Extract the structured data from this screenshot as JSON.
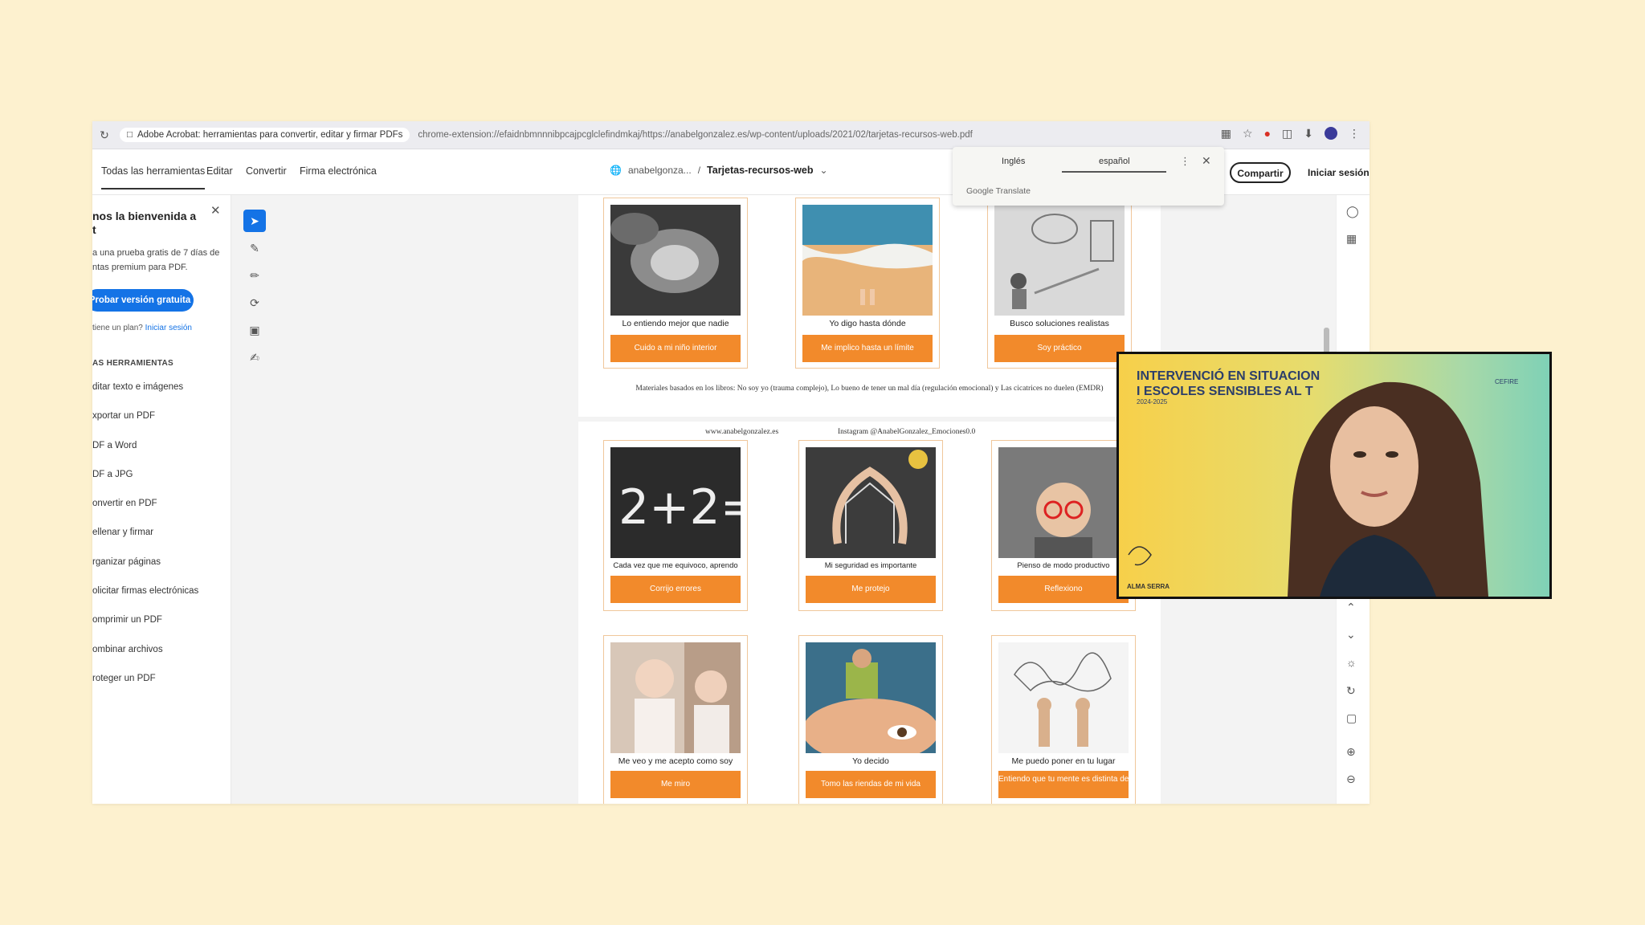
{
  "browser": {
    "tab_label": "Adobe Acrobat: herramientas para convertir, editar y firmar PDFs",
    "url": "chrome-extension://efaidnbmnnnibpcajpcglclefindmkaj/https://anabelgonzalez.es/wp-content/uploads/2021/02/tarjetas-recursos-web.pdf"
  },
  "acrobat": {
    "menu": [
      "Todas las herramientas",
      "Editar",
      "Convertir",
      "Firma electrónica"
    ],
    "doc_path_prefix": "anabelgonza...",
    "doc_separator": "/",
    "doc_name": "Tarjetas-recursos-web",
    "share": "Compartir",
    "login": "Iniciar sesión"
  },
  "translate": {
    "lang_from": "Inglés",
    "lang_to": "español",
    "brand": "Google Translate"
  },
  "left_panel": {
    "title_line1": "nos la bienvenida a",
    "title_line2": "t",
    "desc_line1": "a una prueba gratis de 7 días de",
    "desc_line2": "ntas premium para PDF.",
    "trial_button": "Probar versión gratuita",
    "plan_text": "tiene un plan?",
    "plan_link": "Iniciar sesión",
    "tools_heading": "AS HERRAMIENTAS",
    "tools": [
      "ditar texto e imágenes",
      "xportar un PDF",
      "DF a Word",
      "DF a JPG",
      "onvertir en PDF",
      "ellenar y firmar",
      "rganizar páginas",
      "olicitar firmas electrónicas",
      "omprimir un PDF",
      "ombinar archivos",
      "roteger un PDF"
    ]
  },
  "pdf": {
    "page1_cards": [
      {
        "caption": "Lo entiendo mejor que nadie",
        "button": "Cuido a mi niño interior"
      },
      {
        "caption": "Yo digo hasta dónde",
        "button": "Me implico hasta un límite"
      },
      {
        "caption": "Busco soluciones realistas",
        "button": "Soy práctico"
      }
    ],
    "page1_note": "Materiales basados en los libros: No soy yo (trauma complejo), Lo bueno de tener un mal día (regulación emocional) y Las cicatrices no duelen (EMDR)",
    "page2_website": "www.anabelgonzalez.es",
    "page2_instagram": "Instagram @AnabelGonzalez_Emociones0.0",
    "page2_cards": [
      {
        "caption": "Cada vez que me equivoco, aprendo",
        "button": "Corrijo errores"
      },
      {
        "caption": "Mi seguridad es importante",
        "button": "Me protejo"
      },
      {
        "caption": "Pienso de modo productivo",
        "button": "Reflexiono"
      },
      {
        "caption": "Me veo y me acepto como soy",
        "button": "Me miro"
      },
      {
        "caption": "Yo decido",
        "button": "Tomo las riendas de mi vida"
      },
      {
        "caption": "Me puedo poner en tu lugar",
        "button": "Entiendo que tu mente es distinta de la mía"
      }
    ]
  },
  "webcam": {
    "title_line1": "INTERVENCIÓ EN SITUACION",
    "title_line2": "I ESCOLES SENSIBLES AL T",
    "year": "2024-2025",
    "logo": "CEFIRE",
    "presenter": "ALMA SERRA"
  }
}
